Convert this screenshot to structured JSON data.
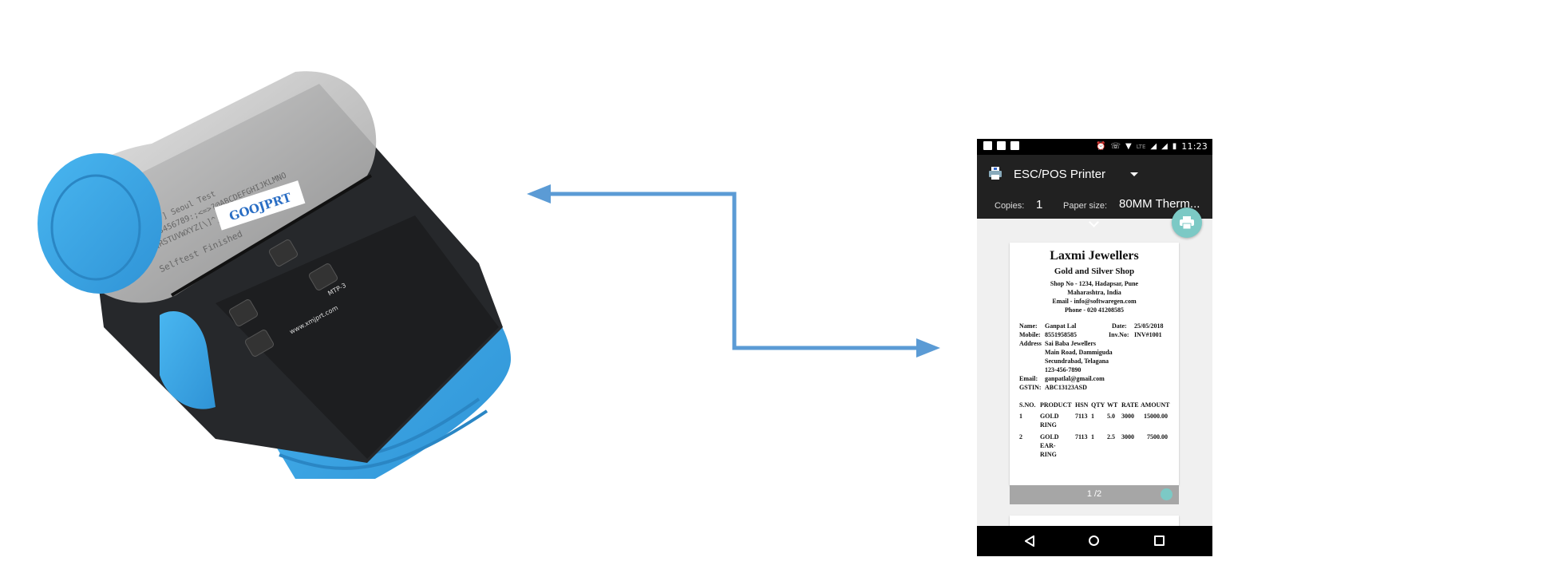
{
  "printer_device": {
    "logo_text": "GOOJPRT",
    "paper_line_1": "[ASC  ] Seoul Test",
    "paper_line_2": "0123456789:;<=>?@ABCDEFGHIJKLMNO",
    "paper_line_3": "PQRSTUVWXYZ[\\]^_`abcdefghijklmno",
    "paper_line_4": "Selftest Finished",
    "brand_url": "www.xmjprt.com",
    "model": "MTP-3"
  },
  "phone": {
    "status_bar": {
      "time": "11:23",
      "network": "LTE"
    },
    "app_bar": {
      "printer_name": "ESC/POS Printer",
      "copies_label": "Copies:",
      "copies_value": "1",
      "paper_size_label": "Paper size:",
      "paper_size_value": "80MM Therm..."
    },
    "receipt": {
      "shop_name": "Laxmi Jewellers",
      "shop_tagline": "Gold and Silver Shop",
      "address_line1": "Shop No - 1234, Hadapsar, Pune",
      "address_line2": "Maharashtra, India",
      "email_line": "Email - info@softwaregen.com",
      "phone_line": "Phone - 020 41208585",
      "name_label": "Name:",
      "name_value": "Ganpat Lal",
      "date_label": "Date:",
      "date_value": "25/05/2018",
      "mobile_label": "Mobile:",
      "mobile_value": "8551958585",
      "inv_label": "Inv.No:",
      "inv_value": "INV#1001",
      "address_label": "Address",
      "address_value_1": "Sai Baba Jewellers",
      "address_value_2": "Main Road, Dammiguda",
      "address_value_3": "Secundrabad, Telagana",
      "address_value_4": "123-456-7890",
      "email_label": "Email:",
      "email_value": "ganpatlal@gmail.com",
      "gstin_label": "GSTIN:",
      "gstin_value": "ABC13123ASD",
      "columns": [
        "S.NO.",
        "PRODUCT",
        "HSN",
        "QTY",
        "WT",
        "RATE",
        "AMOUNT"
      ],
      "rows": [
        {
          "sno": "1",
          "product_1": "GOLD",
          "product_2": "RING",
          "product_3": "",
          "hsn": "7113",
          "qty": "1",
          "wt": "5.0",
          "rate": "3000",
          "amount": "15000.00"
        },
        {
          "sno": "2",
          "product_1": "GOLD",
          "product_2": "EAR-",
          "product_3": "RING",
          "hsn": "7113",
          "qty": "1",
          "wt": "2.5",
          "rate": "3000",
          "amount": "7500.00"
        }
      ]
    },
    "page_indicator": "1 /2"
  },
  "colors": {
    "arrow": "#5b9bd5",
    "printer_accent": "#3aa5e6",
    "app_bar": "#212121",
    "fab": "#7cc9c5",
    "page_footer": "#a6a6a6"
  }
}
